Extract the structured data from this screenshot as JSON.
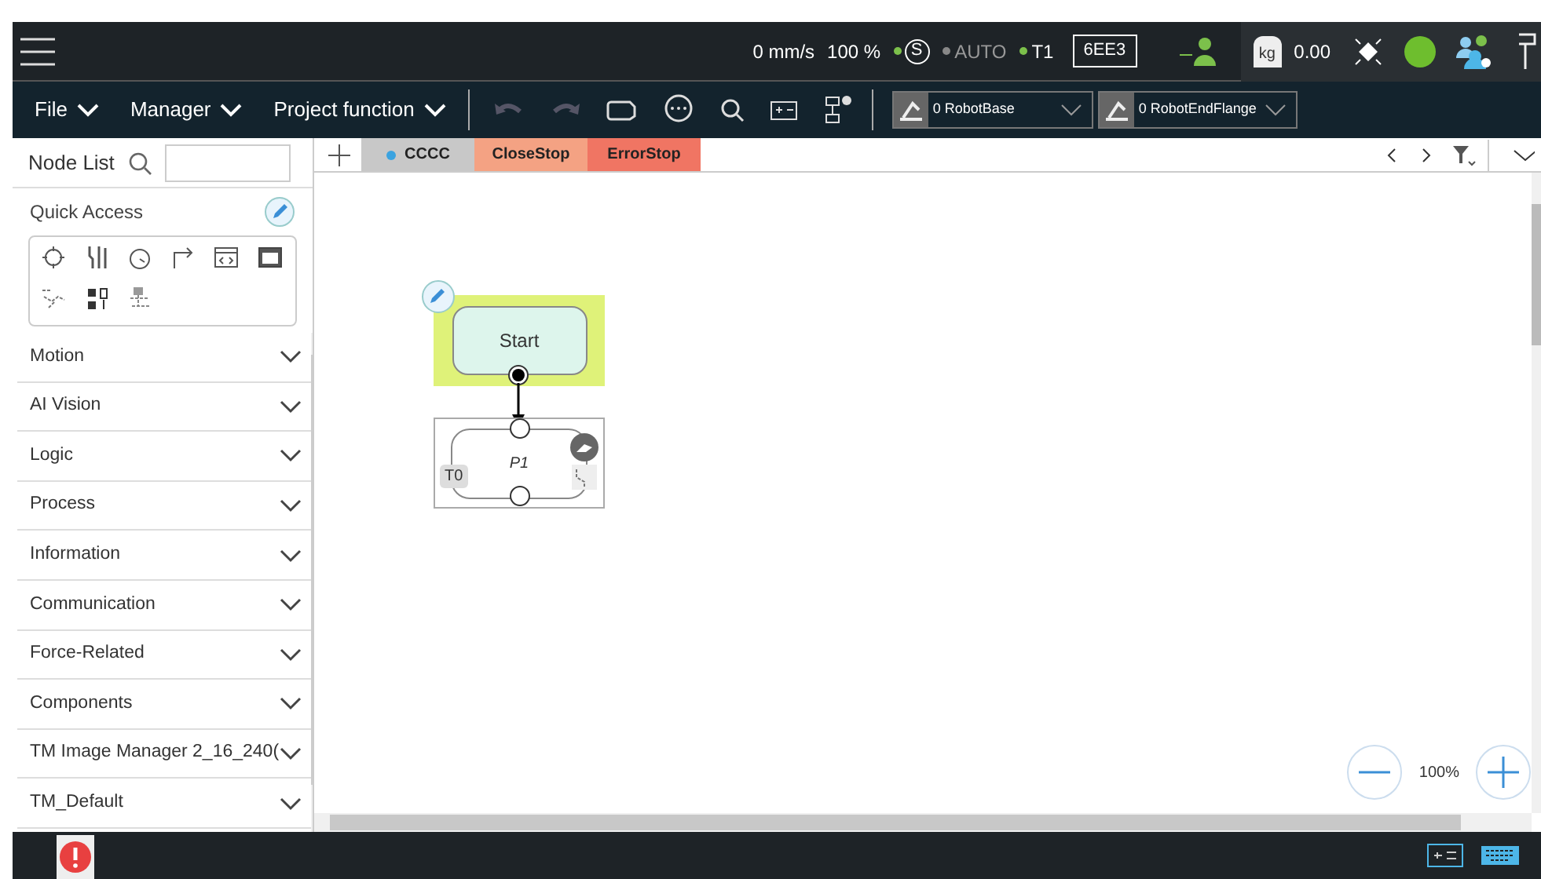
{
  "status_bar": {
    "speed": "0 mm/s",
    "percent": "100 %",
    "safety": "S",
    "mode": "AUTO",
    "mode_active": false,
    "t1": "T1",
    "code": "6EE3",
    "payload": "0.00",
    "payload_unit": "kg"
  },
  "menus": [
    {
      "label": "File"
    },
    {
      "label": "Manager"
    },
    {
      "label": "Project function"
    }
  ],
  "base_select": {
    "value": "0 RobotBase"
  },
  "tool_select": {
    "value": "0 RobotEndFlange"
  },
  "tabs": [
    {
      "label": "CCCC",
      "selected": true,
      "color": "#c8c8c8"
    },
    {
      "label": "CloseStop",
      "selected": false,
      "color": "#f4a283"
    },
    {
      "label": "ErrorStop",
      "selected": false,
      "color": "#f07563"
    }
  ],
  "node_list": {
    "title": "Node List"
  },
  "quick_access": {
    "title": "Quick Access"
  },
  "categories": [
    {
      "label": "Motion"
    },
    {
      "label": "AI Vision"
    },
    {
      "label": "Logic"
    },
    {
      "label": "Process"
    },
    {
      "label": "Information"
    },
    {
      "label": "Communication"
    },
    {
      "label": "Force-Related"
    },
    {
      "label": "Components"
    },
    {
      "label": "TM Image Manager 2_16_240("
    },
    {
      "label": "TM_Default"
    }
  ],
  "flow": {
    "nodes": [
      {
        "kind": "start",
        "label": "Start",
        "selected": true
      },
      {
        "kind": "point",
        "label": "P1",
        "badge": "T0",
        "selected": false
      }
    ]
  },
  "zoom": {
    "reading": "100%"
  }
}
